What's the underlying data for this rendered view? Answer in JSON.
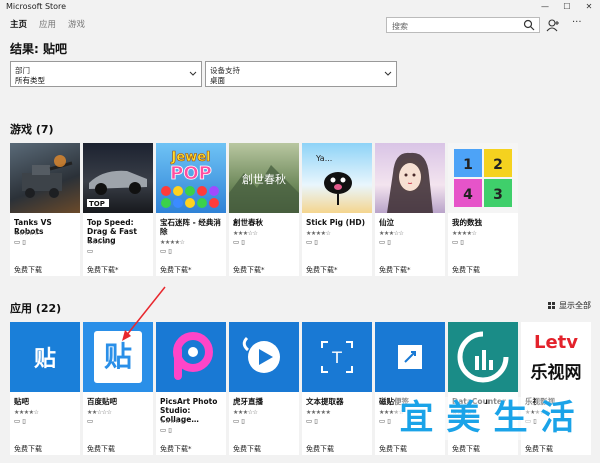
{
  "window": {
    "title": "Microsoft Store"
  },
  "nav": {
    "items": [
      "主页",
      "应用",
      "游戏"
    ],
    "active": 0
  },
  "search": {
    "placeholder": "搜索"
  },
  "results_title": "结果: 贴吧",
  "filters": [
    {
      "label": "部门",
      "value": "所有类型"
    },
    {
      "label": "设备支持",
      "value": "桌面"
    }
  ],
  "games": {
    "title": "游戏 (7)",
    "items": [
      {
        "name": "Tanks VS Robots",
        "stars": "★★★★☆",
        "price": "免费下载",
        "icon": "tank-game-icon"
      },
      {
        "name": "Top Speed: Drag & Fast Racing",
        "stars": "★★★★☆",
        "price": "免费下载*",
        "icon": "car-game-icon"
      },
      {
        "name": "宝石迷阵 - 经典消除",
        "stars": "★★★★☆",
        "price": "免费下载*",
        "icon": "jewel-pop-icon"
      },
      {
        "name": "創世春秋",
        "stars": "★★★☆☆",
        "price": "免费下载*",
        "icon": "chuangshi-icon"
      },
      {
        "name": "Stick Pig (HD)",
        "stars": "★★★★☆",
        "price": "免费下载*",
        "icon": "stick-pig-icon"
      },
      {
        "name": "仙泣",
        "stars": "★★★☆☆",
        "price": "免费下载*",
        "icon": "xianqi-icon"
      },
      {
        "name": "我的数独",
        "stars": "★★★★☆",
        "price": "免费下载",
        "icon": "sudoku-icon"
      }
    ]
  },
  "apps": {
    "title": "应用 (22)",
    "show_all": "显示全部",
    "items": [
      {
        "name": "贴吧",
        "stars": "★★★★☆",
        "price": "免费下载",
        "icon": "tieba-icon"
      },
      {
        "name": "百度贴吧",
        "stars": "★★☆☆☆",
        "price": "免费下载",
        "icon": "baidu-tieba-icon"
      },
      {
        "name": "PicsArt Photo Studio: Collage…",
        "stars": "★★★★☆",
        "price": "免费下载*",
        "icon": "picsart-icon"
      },
      {
        "name": "虎牙直播",
        "stars": "★★★☆☆",
        "price": "免费下载",
        "icon": "huya-icon"
      },
      {
        "name": "文本提取器",
        "stars": "★★★★★",
        "price": "免费下载",
        "icon": "text-extractor-icon"
      },
      {
        "name": "磁贴便签",
        "stars": "★★★★☆",
        "price": "免费下载",
        "icon": "tile-notes-icon"
      },
      {
        "name": "DataCounter",
        "stars": "★★★★☆",
        "price": "免费下载",
        "icon": "datacounter-icon"
      },
      {
        "name": "乐视影视",
        "stars": "★★★☆☆",
        "price": "免费下载",
        "icon": "letv-icon"
      }
    ]
  },
  "logos": {
    "tieba_glyph": "贴",
    "baidu_glyph": "贴",
    "picsart_glyph": "P",
    "letv_top": "Letv",
    "letv_bottom": "乐视网",
    "jewel": "Jewel",
    "pop": "POP",
    "chuangshi": "創世春秋",
    "yan": "Ya...",
    "sudoku": [
      "1",
      "2",
      "4",
      "3"
    ],
    "text_ext": "T"
  },
  "watermark": [
    "宜",
    "美",
    "生",
    "活"
  ],
  "colors": {
    "accent": "#0078d7",
    "datacounter": "#1a8c87"
  }
}
